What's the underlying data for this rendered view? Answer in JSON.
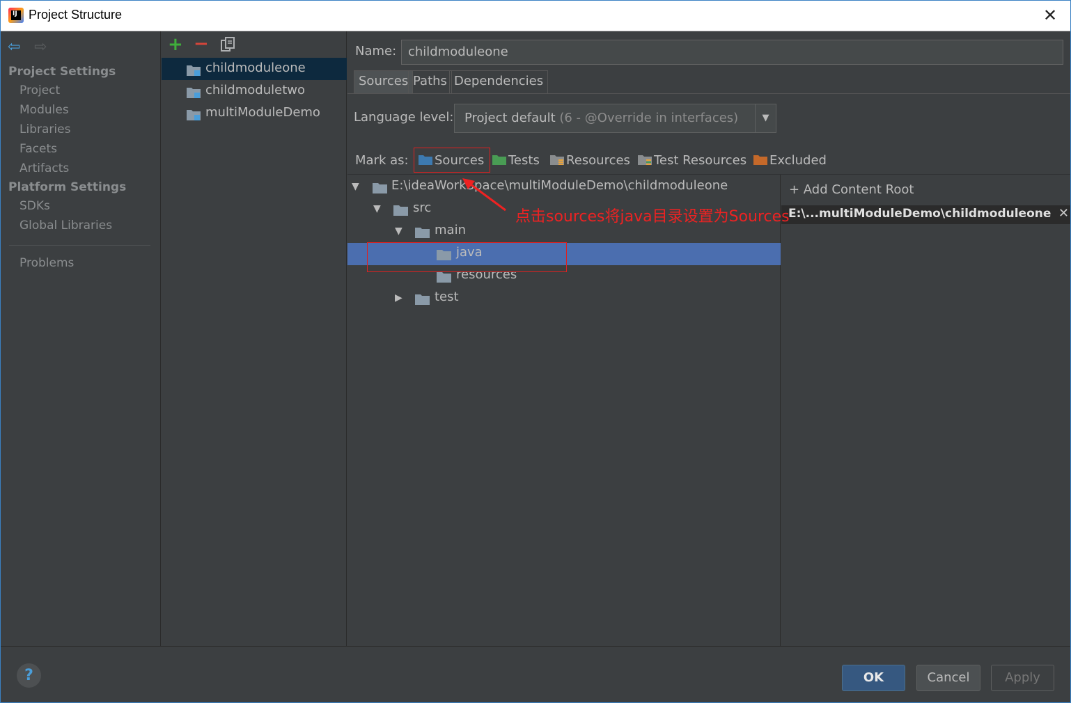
{
  "window": {
    "title": "Project Structure",
    "close_glyph": "✕"
  },
  "nav": {
    "back_glyph": "⇦",
    "forward_glyph": "⇨",
    "project_settings_heading": "Project Settings",
    "project_items": [
      "Project",
      "Modules",
      "Libraries",
      "Facets",
      "Artifacts"
    ],
    "platform_settings_heading": "Platform Settings",
    "platform_items": [
      "SDKs",
      "Global Libraries"
    ],
    "problems": "Problems"
  },
  "modules": {
    "add_glyph": "+",
    "remove_glyph": "−",
    "items": [
      "childmoduleone",
      "childmoduletwo",
      "multiModuleDemo"
    ],
    "selected_index": 0
  },
  "details": {
    "name_label": "Name:",
    "name_value": "childmoduleone",
    "tabs": [
      "Sources",
      "Paths",
      "Dependencies"
    ],
    "active_tab": 0,
    "language_label": "Language level:",
    "language_value": "Project default",
    "language_hint": " (6 - @Override in interfaces)",
    "dropdown_glyph": "▼",
    "mark_as_label": "Mark as:",
    "mark_buttons": [
      {
        "label": "Sources",
        "color": "#3d7ab0"
      },
      {
        "label": "Tests",
        "color": "#499c54"
      },
      {
        "label": "Resources",
        "color": "#8a8d8f"
      },
      {
        "label": "Test Resources",
        "color": "#8a8d8f"
      },
      {
        "label": "Excluded",
        "color": "#c5692a"
      }
    ]
  },
  "tree": {
    "rows": [
      {
        "toggle": "▼",
        "label": "E:\\ideaWorkSpace\\multiModuleDemo\\childmoduleone"
      },
      {
        "toggle": "▼",
        "label": "src"
      },
      {
        "toggle": "▼",
        "label": "main"
      },
      {
        "toggle": "",
        "label": "java"
      },
      {
        "toggle": "",
        "label": "resources"
      },
      {
        "toggle": "▶",
        "label": "test"
      }
    ],
    "selected_index": 3
  },
  "content_root": {
    "add_label": "+ Add Content Root",
    "root_path": "E:\\...multiModuleDemo\\childmoduleone",
    "remove_glyph": "✕"
  },
  "annotation": "点击sources将java目录设置为Sources",
  "footer": {
    "help_glyph": "?",
    "ok": "OK",
    "cancel": "Cancel",
    "apply": "Apply"
  },
  "colors": {
    "background": "#3c3f41",
    "selection": "#4b6eaf",
    "module_selection": "#0d293e",
    "highlight": "#e02020"
  }
}
